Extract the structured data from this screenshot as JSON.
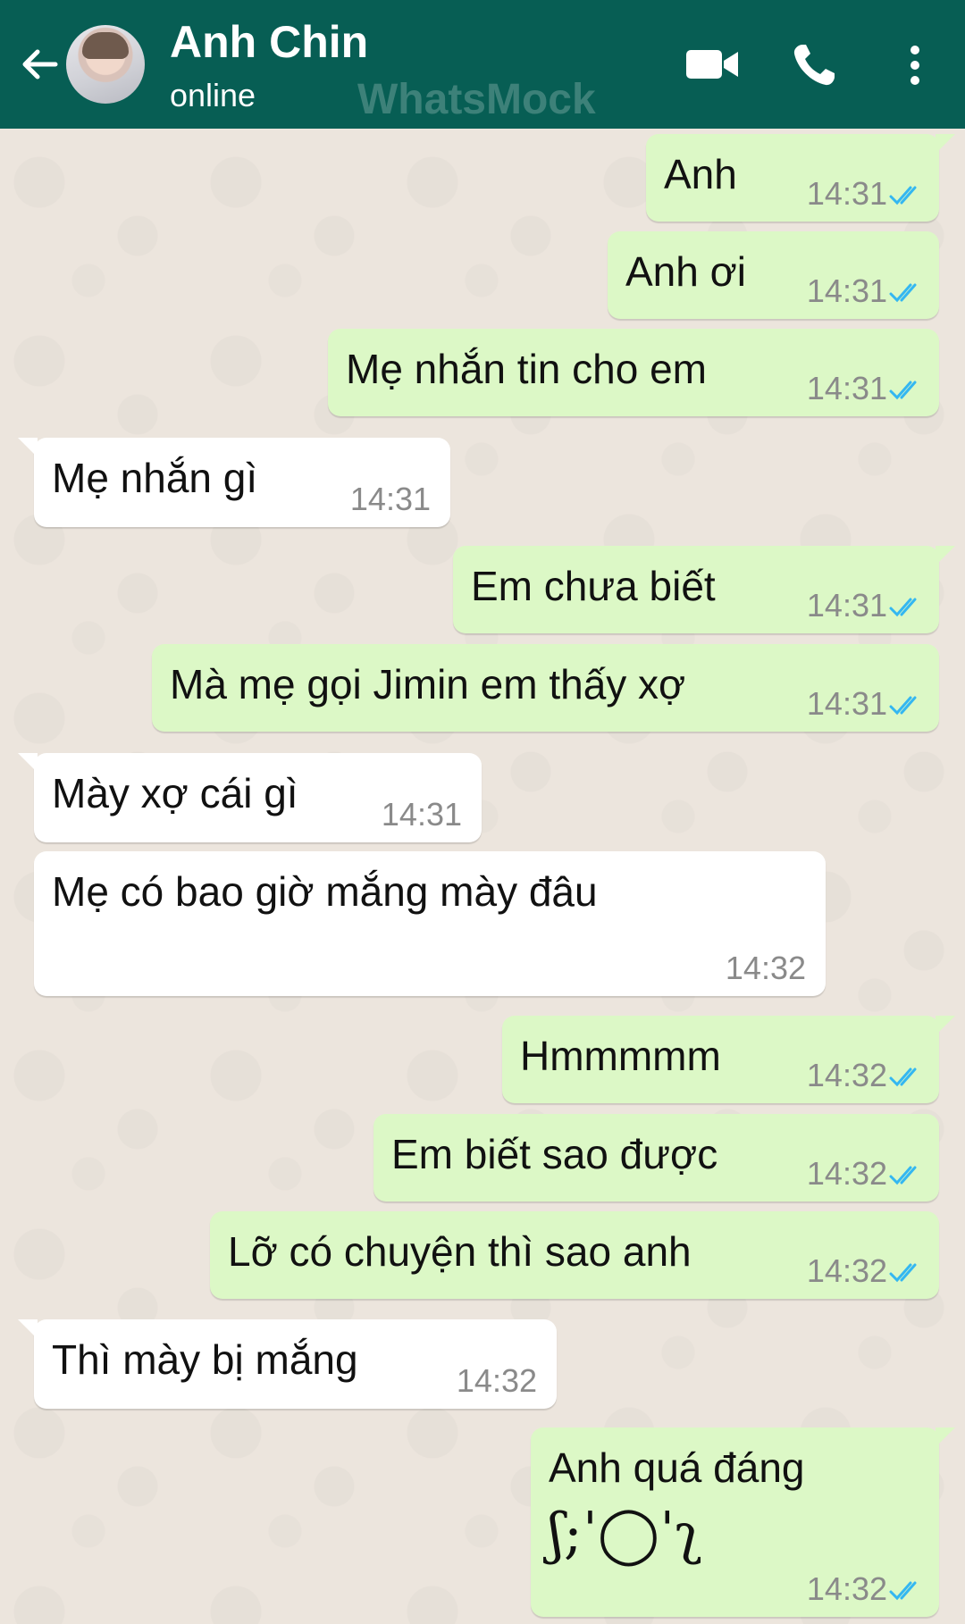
{
  "header": {
    "contact_name": "Anh Chin",
    "status": "online",
    "watermark": "WhatsMock",
    "colors": {
      "bar": "#075e54",
      "outgoing": "#dcf8c6",
      "incoming": "#ffffff",
      "read_ticks": "#34b7f1"
    }
  },
  "messages": [
    {
      "dir": "out",
      "text": "Anh",
      "time": "14:31",
      "status": "read"
    },
    {
      "dir": "out",
      "text": "Anh ơi",
      "time": "14:31",
      "status": "read"
    },
    {
      "dir": "out",
      "text": "Mẹ nhắn tin cho em",
      "time": "14:31",
      "status": "read"
    },
    {
      "dir": "in",
      "text": "Mẹ nhắn gì",
      "time": "14:31"
    },
    {
      "dir": "out",
      "text": "Em chưa biết",
      "time": "14:31",
      "status": "read"
    },
    {
      "dir": "out",
      "text": "Mà mẹ gọi Jimin em thấy xợ",
      "time": "14:31",
      "status": "read"
    },
    {
      "dir": "in",
      "text": "Mày xợ cái gì",
      "time": "14:31"
    },
    {
      "dir": "in",
      "text": "Mẹ có bao giờ mắng mày đâu",
      "time": "14:32"
    },
    {
      "dir": "out",
      "text": "Hmmmmm",
      "time": "14:32",
      "status": "read"
    },
    {
      "dir": "out",
      "text": "Em biết sao được",
      "time": "14:32",
      "status": "read"
    },
    {
      "dir": "out",
      "text": "Lỡ có chuyện thì sao anh",
      "time": "14:32",
      "status": "read"
    },
    {
      "dir": "in",
      "text": "Thì mày bị mắng",
      "time": "14:32"
    },
    {
      "dir": "out",
      "text": "Anh quá đáng",
      "emoticon": "ʃ;ˈ◯ˈʅ",
      "time": "14:32",
      "status": "read"
    }
  ]
}
